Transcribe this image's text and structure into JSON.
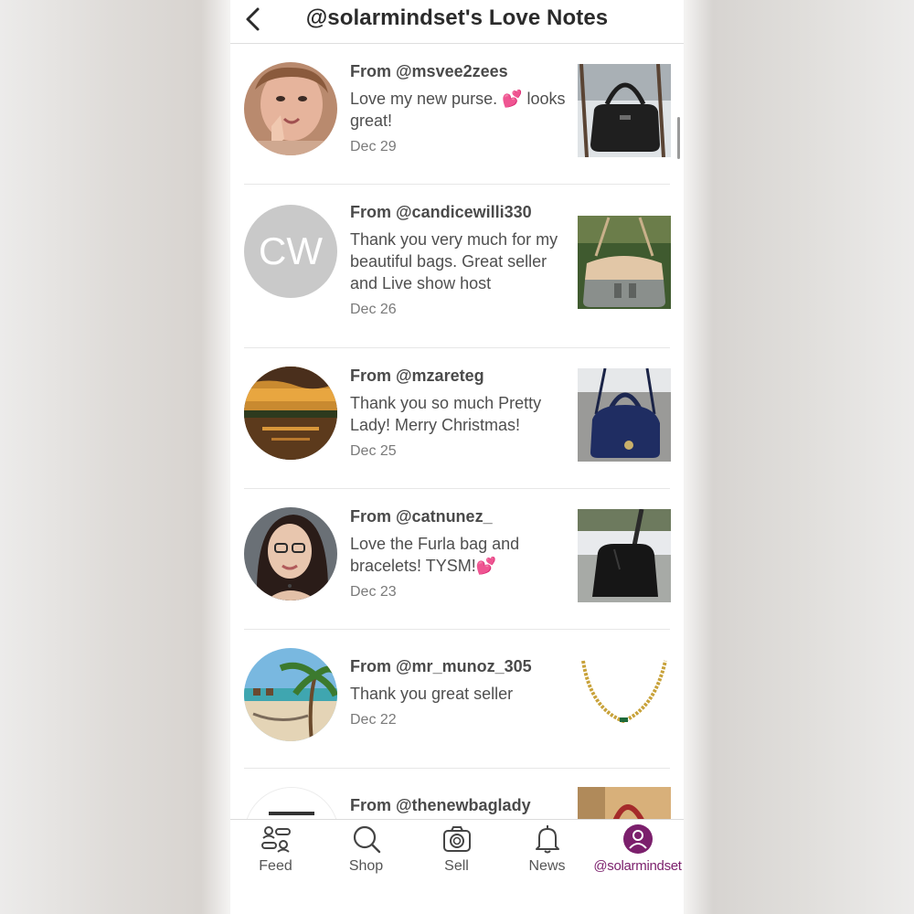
{
  "header": {
    "title": "@solarmindset's Love Notes",
    "back_icon": "chevron-left-icon"
  },
  "notes": [
    {
      "from": "From @msvee2zees",
      "message": "Love my new purse. 💕 looks great!",
      "date": "Dec 29",
      "avatar": "user-photo",
      "thumb": "black-handbag"
    },
    {
      "from": "From @candicewilli330",
      "message": "Thank you very much for my beautiful bags. Great seller and Live show host",
      "date": "Dec 26",
      "avatar_initials": "CW",
      "thumb": "tan-gray-shoulder-bag"
    },
    {
      "from": "From @mzareteg",
      "message": "Thank you so much Pretty Lady! Merry Christmas!",
      "date": "Dec 25",
      "avatar": "sunset-photo",
      "thumb": "navy-dome-bag"
    },
    {
      "from": "From @catnunez_",
      "message": "Love the Furla bag and bracelets! TYSM!💕",
      "date": "Dec 23",
      "avatar": "user-photo",
      "thumb": "black-tote-bag"
    },
    {
      "from": "From @mr_munoz_305",
      "message": "Thank you great seller",
      "date": "Dec 22",
      "avatar": "beach-photo",
      "thumb": "gold-chain-necklace"
    },
    {
      "from": "From @thenewbaglady",
      "message": "",
      "date": "",
      "avatar": "logo-photo",
      "thumb": "red-bag"
    }
  ],
  "tabs": [
    {
      "label": "Feed",
      "icon": "feed-icon"
    },
    {
      "label": "Shop",
      "icon": "search-icon"
    },
    {
      "label": "Sell",
      "icon": "camera-icon"
    },
    {
      "label": "News",
      "icon": "bell-icon"
    },
    {
      "label": "@solarmindset",
      "icon": "profile-icon",
      "active": true
    }
  ],
  "colors": {
    "accent": "#7b1f6c",
    "text": "#4a4a4a",
    "muted": "#7a7a7a",
    "divider": "#e7e7e7"
  }
}
